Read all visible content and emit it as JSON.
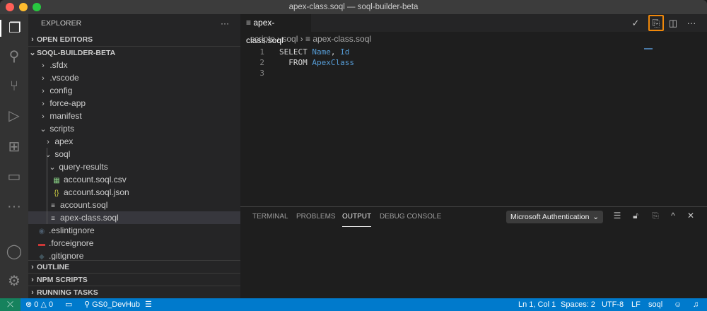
{
  "window": {
    "title": "apex-class.soql — soql-builder-beta"
  },
  "activity_bar": [
    "explorer-icon",
    "search-icon",
    "source-control-icon",
    "run-debug-icon",
    "extensions-icon",
    "remote-explorer-icon",
    "more-icon",
    "account-icon",
    "settings-gear-icon"
  ],
  "sidebar": {
    "title": "EXPLORER",
    "more": "···",
    "open_editors": "OPEN EDITORS",
    "project": "SOQL-BUILDER-BETA",
    "tree": [
      {
        "label": ".sfdx",
        "type": "folder",
        "expanded": false,
        "level": 1
      },
      {
        "label": ".vscode",
        "type": "folder",
        "expanded": false,
        "level": 1
      },
      {
        "label": "config",
        "type": "folder",
        "expanded": false,
        "level": 1
      },
      {
        "label": "force-app",
        "type": "folder",
        "expanded": false,
        "level": 1
      },
      {
        "label": "manifest",
        "type": "folder",
        "expanded": false,
        "level": 1
      },
      {
        "label": "scripts",
        "type": "folder",
        "expanded": true,
        "level": 1
      },
      {
        "label": "apex",
        "type": "folder",
        "expanded": false,
        "level": 2
      },
      {
        "label": "soql",
        "type": "folder",
        "expanded": true,
        "level": 2
      },
      {
        "label": "query-results",
        "type": "folder",
        "expanded": true,
        "level": 3
      },
      {
        "label": "account.soql.csv",
        "type": "csv",
        "level": 4
      },
      {
        "label": "account.soql.json",
        "type": "json",
        "level": 4
      },
      {
        "label": "account.soql",
        "type": "soql",
        "level": 3
      },
      {
        "label": "apex-class.soql",
        "type": "soql",
        "level": 3,
        "selected": true
      },
      {
        "label": ".eslintignore",
        "type": "eslint",
        "level": 0
      },
      {
        "label": ".forceignore",
        "type": "npm",
        "level": 0
      },
      {
        "label": ".gitignore",
        "type": "git",
        "level": 0
      }
    ],
    "sections": [
      "OUTLINE",
      "NPM SCRIPTS",
      "RUNNING TASKS"
    ]
  },
  "editor": {
    "tab": "apex-class.soql",
    "breadcrumb": [
      "scripts",
      "soql",
      "apex-class.soql"
    ],
    "lines": [
      {
        "n": "1",
        "tokens": [
          {
            "t": "SELECT ",
            "c": "kw"
          },
          {
            "t": "Name",
            "c": "id"
          },
          {
            "t": ", ",
            "c": "kw"
          },
          {
            "t": "Id",
            "c": "id"
          }
        ]
      },
      {
        "n": "2",
        "tokens": [
          {
            "t": "  FROM ",
            "c": "kw"
          },
          {
            "t": "ApexClass",
            "c": "id"
          }
        ]
      },
      {
        "n": "3",
        "tokens": []
      }
    ],
    "highlight_color": "#f0880a"
  },
  "panel": {
    "tabs": [
      "TERMINAL",
      "PROBLEMS",
      "OUTPUT",
      "DEBUG CONSOLE"
    ],
    "active": "OUTPUT",
    "channel": "Microsoft Authentication"
  },
  "status": {
    "errors": "0",
    "warnings": "0",
    "org": "GS0_DevHub",
    "position": "Ln 1, Col 1",
    "spaces": "Spaces: 2",
    "encoding": "UTF-8",
    "eol": "LF",
    "language": "soql"
  }
}
